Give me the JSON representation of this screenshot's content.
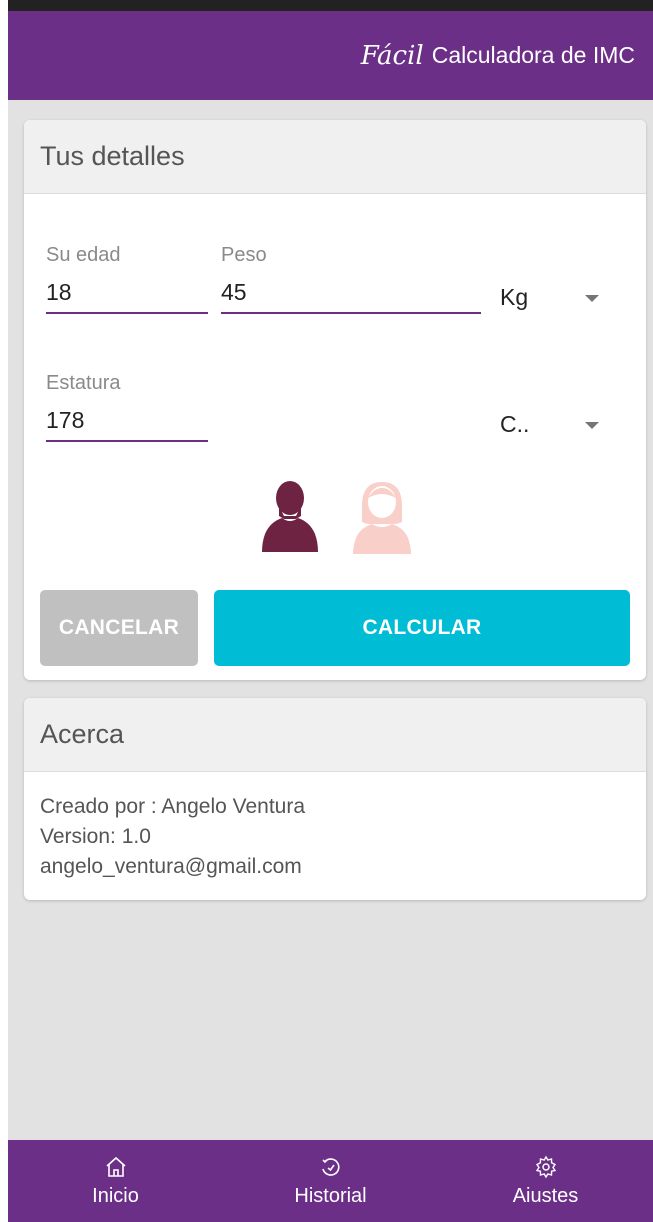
{
  "appbar": {
    "script_word": "Fácil",
    "title": "Calculadora de IMC"
  },
  "details": {
    "header": "Tus detalles",
    "age": {
      "label": "Su edad",
      "value": "18"
    },
    "weight": {
      "label": "Peso",
      "value": "45",
      "unit": "Kg"
    },
    "height": {
      "label": "Estatura",
      "value": "178",
      "unit": "C.."
    },
    "gender": {
      "selected": "male",
      "male_icon": "male-person-icon",
      "female_icon": "female-person-icon"
    },
    "cancel_label": "CANCELAR",
    "calculate_label": "CALCULAR"
  },
  "about": {
    "header": "Acerca",
    "created_by": "Creado por : Angelo Ventura",
    "version": "Version: 1.0",
    "email": "angelo_ventura@gmail.com"
  },
  "nav": {
    "items": [
      {
        "label": "Inicio",
        "icon": "home-icon"
      },
      {
        "label": "Historial",
        "icon": "history-icon"
      },
      {
        "label": "Aiustes",
        "icon": "settings-icon"
      }
    ]
  },
  "colors": {
    "primary": "#6c2f88",
    "accent": "#00bcd4",
    "male_selected": "#6e2342",
    "female_unselected": "#f9cfc9"
  }
}
